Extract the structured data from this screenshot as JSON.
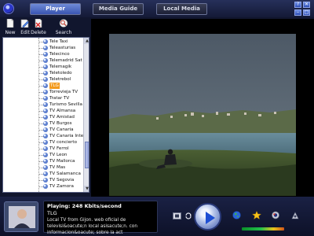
{
  "tabs": {
    "player": "Player",
    "media_guide": "Media Guide",
    "local_media": "Local Media"
  },
  "toolbar": {
    "new": "New",
    "edit": "Edit",
    "delete": "Delete",
    "search": "Search"
  },
  "channels": [
    "Tele Taxi",
    "Teleasturias",
    "Telecinco",
    "Telemadrid Sat",
    "Telemagik",
    "Teletoledo",
    "Teletrebol",
    "TLG",
    "Torrevieja TV",
    "Tratar TV",
    "Turismo Sevilla T",
    "TV Almansa",
    "TV Amistad",
    "TV Burgos",
    "TV Canaria",
    "TV Canaria Intern",
    "TV concierto",
    "TV Ferrol",
    "TV Leon",
    "TV Mallorca",
    "TV Mas",
    "TV Salamanca",
    "TV Segovia",
    "TV Zamora"
  ],
  "selected_channel": "TLG",
  "now_playing": {
    "status": "Playing: 248 Kbits/second",
    "channel": "TLG",
    "description": "Local TV from Gijon. web oficial de televisi&oacute;n local asisacute;n. con informacion&oacute; sobre la act"
  },
  "icons": {
    "app_logo": "app-logo-icon",
    "new": "new-document-icon",
    "edit": "edit-icon",
    "delete": "delete-icon",
    "search": "search-icon",
    "play": "play-icon",
    "stop": "stop-icon",
    "repeat": "repeat-icon",
    "globe": "globe-icon",
    "favorite": "star-icon",
    "settings": "settings-icon",
    "record": "record-icon"
  },
  "colors": {
    "accent": "#3a55b2",
    "selection": "#f39a1d",
    "panel": "#11162e"
  },
  "volume_level": 1.0
}
